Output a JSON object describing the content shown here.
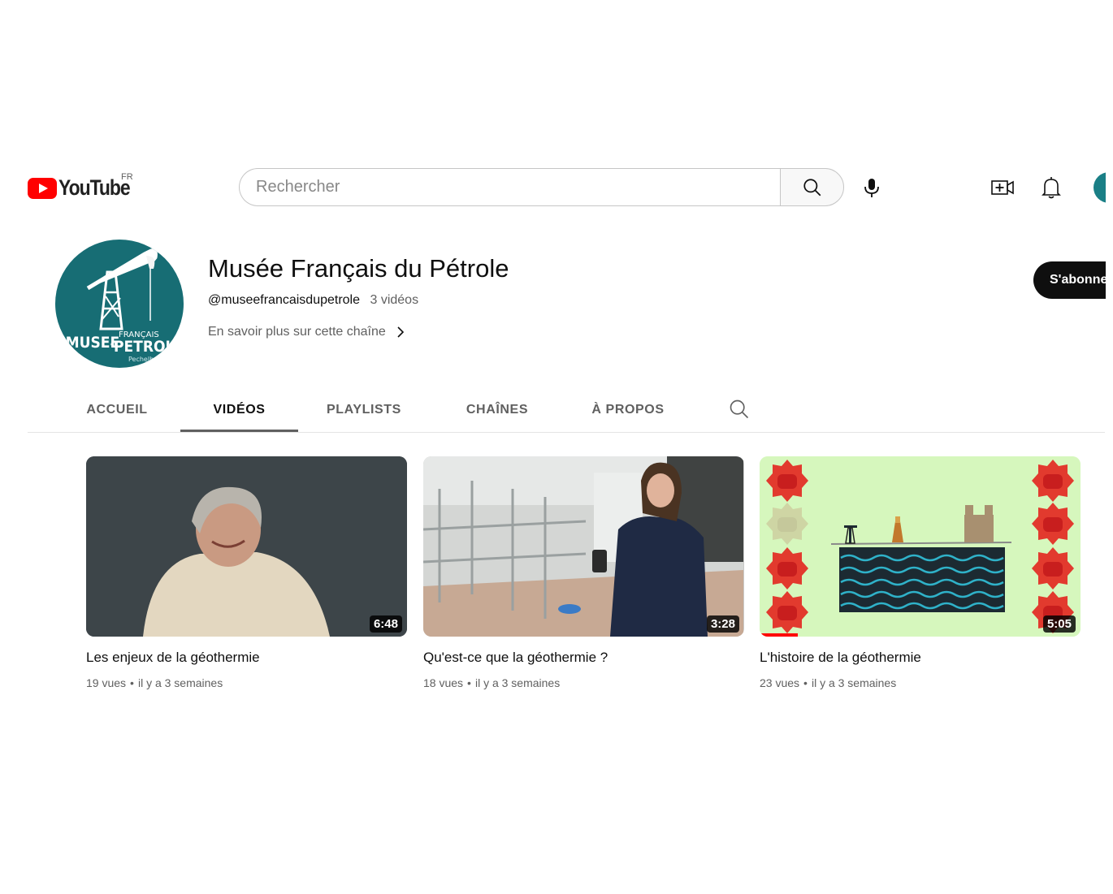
{
  "header": {
    "logo_text": "YouTube",
    "country_code": "FR",
    "search_placeholder": "Rechercher"
  },
  "channel": {
    "name": "Musée Français du Pétrole",
    "handle": "@museefrancaisdupetrole",
    "video_count": "3 vidéos",
    "more_link": "En savoir plus sur cette chaîne",
    "subscribe_label": "S'abonner"
  },
  "tabs": [
    {
      "label": "ACCUEIL",
      "active": false
    },
    {
      "label": "VIDÉOS",
      "active": true
    },
    {
      "label": "PLAYLISTS",
      "active": false
    },
    {
      "label": "CHAÎNES",
      "active": false
    },
    {
      "label": "À PROPOS",
      "active": false
    }
  ],
  "videos": [
    {
      "title": "Les enjeux de la géothermie",
      "views": "19 vues",
      "age": "il y a 3 semaines",
      "duration": "6:48"
    },
    {
      "title": "Qu'est-ce que la géothermie ?",
      "views": "18 vues",
      "age": "il y a 3 semaines",
      "duration": "3:28"
    },
    {
      "title": "L'histoire de la géothermie",
      "views": "23 vues",
      "age": "il y a 3 semaines",
      "duration": "5:05",
      "watched_fraction": 0.12
    }
  ],
  "colors": {
    "brand_red": "#ff0000",
    "avatar_teal": "#176d74",
    "subscribe_bg": "#0f0f0f"
  }
}
